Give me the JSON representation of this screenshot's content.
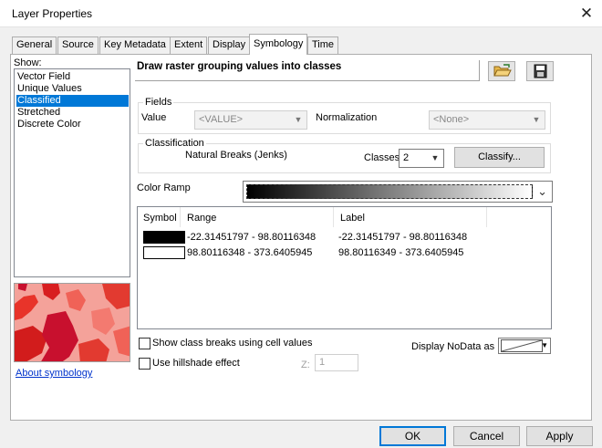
{
  "window": {
    "title": "Layer Properties",
    "close_glyph": "✕"
  },
  "tabs": [
    {
      "label": "General"
    },
    {
      "label": "Source"
    },
    {
      "label": "Key Metadata"
    },
    {
      "label": "Extent"
    },
    {
      "label": "Display"
    },
    {
      "label": "Symbology",
      "active": true
    },
    {
      "label": "Time"
    }
  ],
  "show": {
    "label": "Show:",
    "items": [
      {
        "label": "Vector Field"
      },
      {
        "label": "Unique Values"
      },
      {
        "label": "Classified",
        "selected": true
      },
      {
        "label": "Stretched"
      },
      {
        "label": "Discrete Color"
      }
    ],
    "about_link": "About symbology"
  },
  "heading": "Draw raster grouping values into classes",
  "toolbar": {
    "open_icon": "folder-open-icon",
    "save_icon": "save-icon"
  },
  "fields": {
    "group_label": "Fields",
    "value_label": "Value",
    "value_selected": "<VALUE>",
    "normalization_label": "Normalization",
    "normalization_selected": "<None>"
  },
  "classification": {
    "group_label": "Classification",
    "method": "Natural Breaks (Jenks)",
    "classes_label": "Classes",
    "classes_value": "2",
    "classify_button": "Classify..."
  },
  "color_ramp": {
    "label": "Color Ramp",
    "gradient_from": "#000000",
    "gradient_to": "#ffffff"
  },
  "table": {
    "headers": {
      "symbol": "Symbol",
      "range": "Range",
      "label": "Label"
    },
    "rows": [
      {
        "color": "#000000",
        "range": "-22.31451797 - 98.80116348",
        "label": "-22.31451797 - 98.80116348"
      },
      {
        "color": "#ffffff",
        "range": "98.80116348 - 373.6405945",
        "label": "98.80116349 - 373.6405945"
      }
    ]
  },
  "options": {
    "show_breaks": {
      "label": "Show class breaks using cell values",
      "checked": false
    },
    "hillshade": {
      "label": "Use hillshade effect",
      "checked": false
    },
    "z_label": "Z:",
    "z_value": "1",
    "nodata_label": "Display NoData as"
  },
  "buttons": {
    "ok": "OK",
    "cancel": "Cancel",
    "apply": "Apply"
  },
  "colors": {
    "accent": "#0078d7",
    "link": "#0033cc",
    "preview_dark": "#c8102e",
    "preview_light": "#f4a29a"
  }
}
